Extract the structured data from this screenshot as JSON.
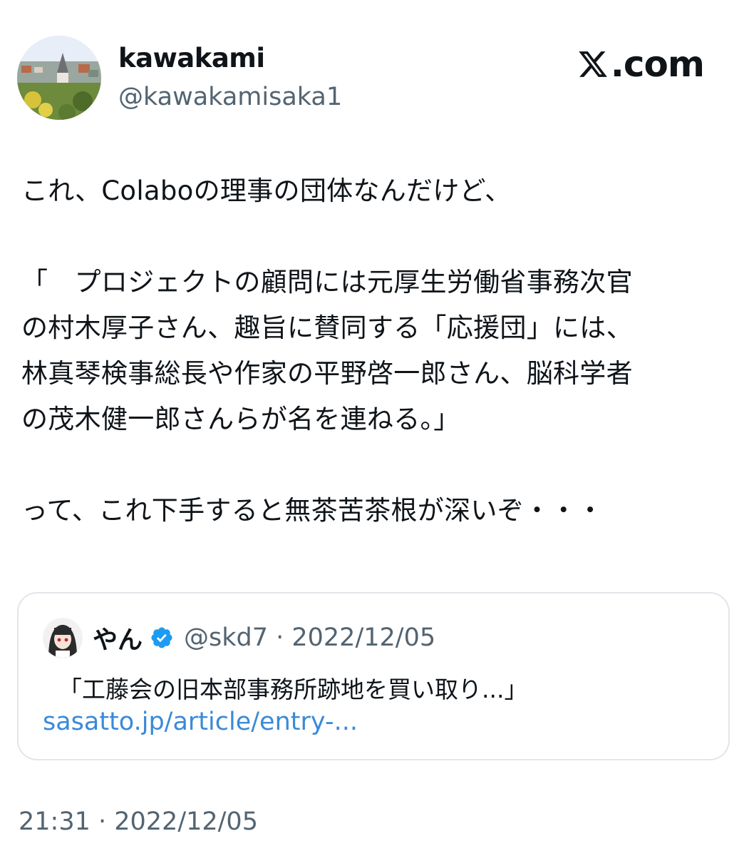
{
  "brand": {
    "name": "X.com",
    "label": ".com",
    "icon": "x-logo-icon"
  },
  "author": {
    "display_name": "kawakami",
    "handle": "@kawakamisaka1",
    "avatar": "avatar-photo"
  },
  "tweet": {
    "lines": [
      "これ、Colaboの理事の団体なんだけど、",
      "",
      "「　プロジェクトの顧問には元厚生労働省事務次官",
      "の村木厚子さん、趣旨に賛同する「応援団」には、",
      "林真琴検事総長や作家の平野啓一郎さん、脳科学者",
      "の茂木健一郎さんらが名を連ねる。」",
      "",
      "って、これ下手すると無茶苦茶根が深いぞ・・・"
    ],
    "timestamp": "21:31 · 2022/12/05"
  },
  "quote": {
    "display_name": "やん",
    "meta": "@skd7 · 2022/12/05",
    "verified_icon": "verified-badge-icon",
    "text": "「工藤会の旧本部事務所跡地を買い取り...」",
    "link": "sasatto.jp/article/entry-..."
  },
  "colors": {
    "text": "#0f1419",
    "muted": "#536471",
    "link": "#3a8ad8",
    "border": "#e2e6ea",
    "verified": "#1d9bf0"
  }
}
